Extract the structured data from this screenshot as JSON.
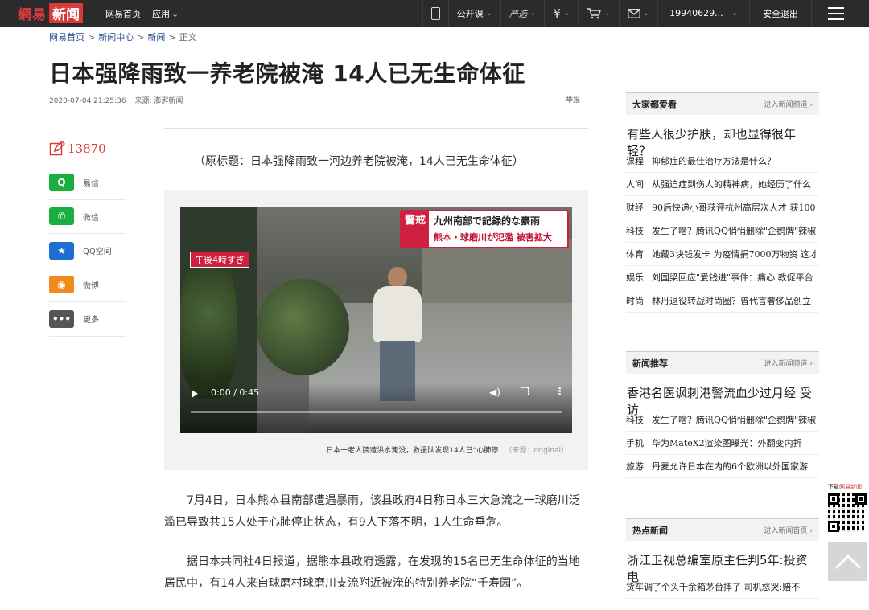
{
  "topbar": {
    "logo_part1": "網易",
    "logo_part2": "新闻",
    "nav": [
      "网易首页",
      "应用"
    ],
    "right": {
      "phone_label": "手机",
      "open_course": "公开课",
      "yanxuan": "严选",
      "user": "19940629...",
      "logout": "安全退出"
    }
  },
  "breadcrumb": [
    "网易首页",
    "新闻中心",
    "新闻",
    "正文"
  ],
  "article": {
    "title": "日本强降雨致一养老院被淹 14人已无生命体征",
    "datetime": "2020-07-04 21:25:36",
    "source": "来源: 澎湃新闻",
    "report": "举报",
    "intro": "（原标题：日本强降雨致一河边养老院被淹，14人已无生命体征）",
    "video": {
      "time": "0:00 / 0:45",
      "progress": 0,
      "overlay_tag": "午後4時すぎ",
      "banner_warn": "警戒",
      "banner_line1": "九州南部で記録的な豪雨",
      "banner_line2": "熊本・球磨川が氾濫 被害拡大"
    },
    "caption": "日本一老人院遭洪水淹没，救援队发现14人已“心肺停",
    "caption_source": "（来源：original）",
    "paragraphs": [
      "7月4日，日本熊本县南部遭遇暴雨，该县政府4日称日本三大急流之一球磨川泛滥已导致共15人处于心肺停止状态，有9人下落不明，1人生命垂危。",
      "据日本共同社4日报道，据熊本县政府透露，在发现的15名已无生命体征的当地居民中，有14人来自球磨村球磨川支流附近被淹的特别养老院“千寿园”。"
    ]
  },
  "share": {
    "comment_count": "13870",
    "items": [
      {
        "label": "易信",
        "icon": "yixin-icon",
        "color": "#1aae3e",
        "glyph": "Q"
      },
      {
        "label": "微信",
        "icon": "wechat-icon",
        "color": "#1aae3e",
        "glyph": "✆"
      },
      {
        "label": "QQ空间",
        "icon": "qzone-icon",
        "color": "#1e6fd0",
        "glyph": "★"
      },
      {
        "label": "微博",
        "icon": "weibo-icon",
        "color": "#f08a1c",
        "glyph": "◉"
      },
      {
        "label": "更多",
        "icon": "more-icon",
        "color": "#555555",
        "glyph": "•••"
      }
    ]
  },
  "sidebar": {
    "popular": {
      "heading": "大家都爱看",
      "more": "进入新闻频道",
      "lead": "有些人很少护肤，却也显得很年轻？",
      "rows": [
        {
          "cat": "课程",
          "text": "抑郁症的最佳治疗方法是什么？"
        },
        {
          "cat": "人间",
          "text": "从强迫症到伤人的精神病，她经历了什么"
        },
        {
          "cat": "财经",
          "text": "90后快递小哥获评杭州高层次人才 获100"
        },
        {
          "cat": "科技",
          "text": "发生了啥？腾讯QQ悄悄删除\"企鹅牌\"辣椒"
        },
        {
          "cat": "体育",
          "text": "她藏3块钱发卡 为疫情捐7000万物资 这才"
        },
        {
          "cat": "娱乐",
          "text": "刘国梁回应\"爱钱进\"事件：痛心 教促平台"
        },
        {
          "cat": "时尚",
          "text": "林丹退役转战时尚圈？曾代言奢侈品创立"
        }
      ]
    },
    "recommend": {
      "heading": "新闻推荐",
      "more": "进入新闻频道",
      "lead": "香港名医讽刺港警流血少过月经 受访",
      "rows": [
        {
          "cat": "科技",
          "text": "发生了啥？腾讯QQ悄悄删除\"企鹅牌\"辣椒"
        },
        {
          "cat": "手机",
          "text": "华为MateX2渲染图曝光：外翻变内折"
        },
        {
          "cat": "旅游",
          "text": "丹麦允许日本在内的6个欧洲以外国家游"
        }
      ]
    },
    "hot": {
      "heading": "热点新闻",
      "more": "进入新闻首页",
      "lead": "浙江卫视总编室原主任判5年:投资电",
      "rows": [
        {
          "cat": "",
          "text": "货车调了个头千余箱茅台摔了 司机愁哭:赔不"
        }
      ]
    }
  },
  "float": {
    "qr_label_prefix": "下载",
    "qr_label_brand": "网易新闻"
  }
}
